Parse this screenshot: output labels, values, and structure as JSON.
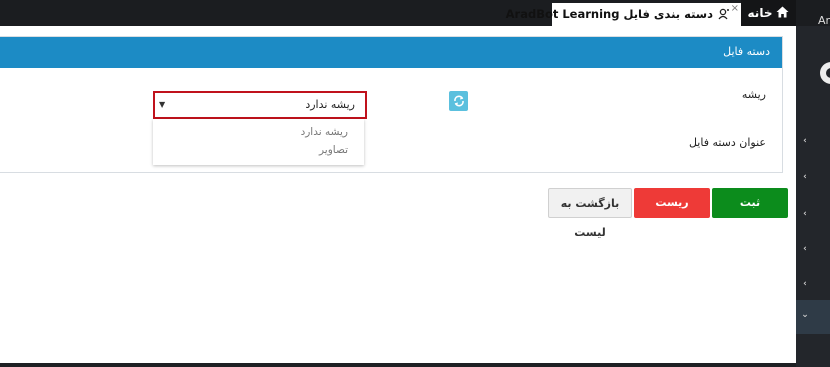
{
  "tabs": {
    "home_label": "خانه",
    "active_label": "دسته بندی فایل AradBot Learning",
    "close_glyph": "×",
    "user_fragment": "Ar"
  },
  "panel": {
    "title": "دسته فایل"
  },
  "form": {
    "root_label": "ریشه",
    "root_value": "ریشه ندارد",
    "root_options": [
      "ریشه ندارد",
      "تصاویر"
    ],
    "title_label": "عنوان دسته فایل"
  },
  "buttons": {
    "submit": "ثبت",
    "reset": "ریست",
    "back": "بازگشت به لیست"
  },
  "colors": {
    "header": "#1c8bc5",
    "submit": "#0c8c1c",
    "reset": "#ee3a37",
    "select_border": "#c0121c"
  }
}
